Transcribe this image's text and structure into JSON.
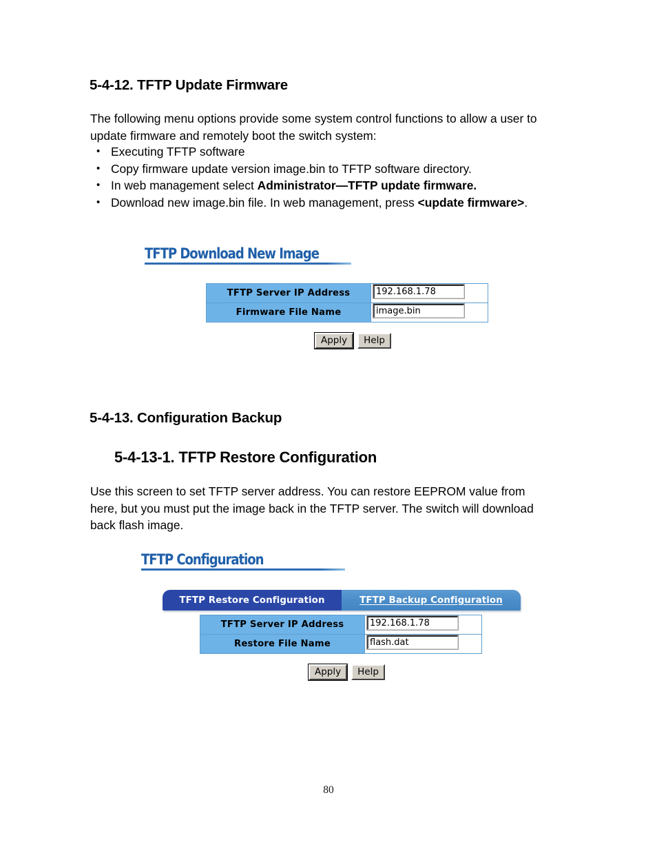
{
  "document": {
    "page_number": "80",
    "sections": [
      {
        "heading": "5-4-12. TFTP Update Firmware",
        "intro": "The following menu options provide some system control functions to allow a user to update firmware and remotely boot the switch system:",
        "bullets": [
          {
            "text": "Executing TFTP software"
          },
          {
            "text": "Copy firmware update version image.bin to TFTP software directory."
          },
          {
            "text_before": "In web management select ",
            "bold": "Administrator—TFTP update firmware.",
            "text_after": ""
          },
          {
            "text_before": "Download new image.bin file.  In web management, press ",
            "bold": "<update firmware>",
            "text_after": "."
          }
        ]
      },
      {
        "heading": "5-4-13. Configuration Backup",
        "subheading": "5-4-13-1. TFTP Restore Configuration",
        "intro": "Use this screen to set TFTP server address. You can restore EEPROM value from here, but you must put the image back in the TFTP server.  The switch will download back flash image."
      }
    ]
  },
  "screenshot_firmware": {
    "title": "TFTP Download New Image",
    "rows": [
      {
        "label": "TFTP Server IP Address",
        "value": "192.168.1.78"
      },
      {
        "label": "Firmware File Name",
        "value": "image.bin"
      }
    ],
    "buttons": {
      "apply": "Apply",
      "help": "Help"
    }
  },
  "screenshot_configuration": {
    "title": "TFTP Configuration",
    "tabs": [
      {
        "label": "TFTP Restore Configuration",
        "active": true
      },
      {
        "label": "TFTP Backup Configuration",
        "active": false
      }
    ],
    "rows": [
      {
        "label": "TFTP Server IP Address",
        "value": "192.168.1.78"
      },
      {
        "label": "Restore File Name",
        "value": "flash.dat"
      }
    ],
    "buttons": {
      "apply": "Apply",
      "help": "Help"
    }
  },
  "colors": {
    "title_blue": "#1F5FA9",
    "label_cell_blue": "#6DB3E8",
    "tab_active_navy": "#2A47A8",
    "tab_inactive_blue": "#4A8CC8",
    "button_face": "#D4D0C8"
  }
}
